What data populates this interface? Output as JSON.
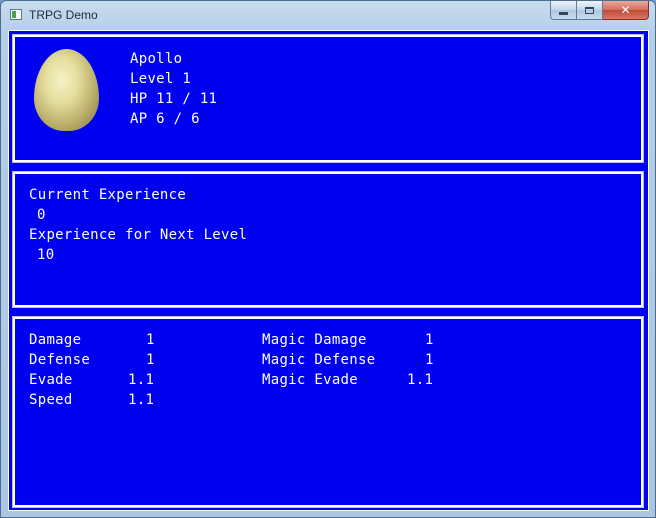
{
  "window": {
    "title": "TRPG Demo",
    "controls": {
      "minimize": "minimize",
      "maximize": "maximize",
      "close": "✕"
    }
  },
  "character": {
    "portrait": "egg-portrait",
    "name": "Apollo",
    "level": "Level 1",
    "hp": "HP 11 / 11",
    "ap": "AP 6 / 6"
  },
  "experience": {
    "current_label": "Current Experience",
    "current_value": "0",
    "next_label": "Experience for Next Level",
    "next_value": "10"
  },
  "stats": {
    "left": [
      {
        "label": "Damage",
        "value": "1"
      },
      {
        "label": "Defense",
        "value": "1"
      },
      {
        "label": "Evade",
        "value": "1.1"
      },
      {
        "label": "Speed",
        "value": "1.1"
      }
    ],
    "right": [
      {
        "label": "Magic Damage",
        "value": "1"
      },
      {
        "label": "Magic Defense",
        "value": "1"
      },
      {
        "label": "Magic Evade",
        "value": "1.1"
      }
    ]
  },
  "colors": {
    "panel_background": "#0000f0",
    "text": "#ffffff",
    "border": "#ffffff"
  }
}
